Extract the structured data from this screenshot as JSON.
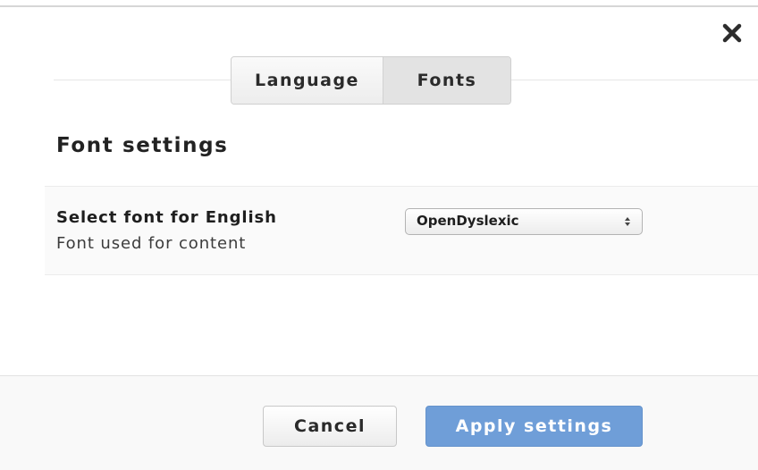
{
  "dialog": {
    "close_icon": "close-icon"
  },
  "tabs": [
    {
      "label": "Language",
      "active": false
    },
    {
      "label": "Fonts",
      "active": true
    }
  ],
  "section": {
    "title": "Font settings"
  },
  "setting": {
    "label": "Select font for English",
    "description": "Font used for content",
    "select": {
      "value": "OpenDyslexic",
      "arrow_icon": "select-arrows-icon"
    }
  },
  "footer": {
    "cancel_label": "Cancel",
    "apply_label": "Apply settings"
  },
  "colors": {
    "primary_button": "#6f9ed8",
    "active_tab": "#e3e3e3"
  }
}
